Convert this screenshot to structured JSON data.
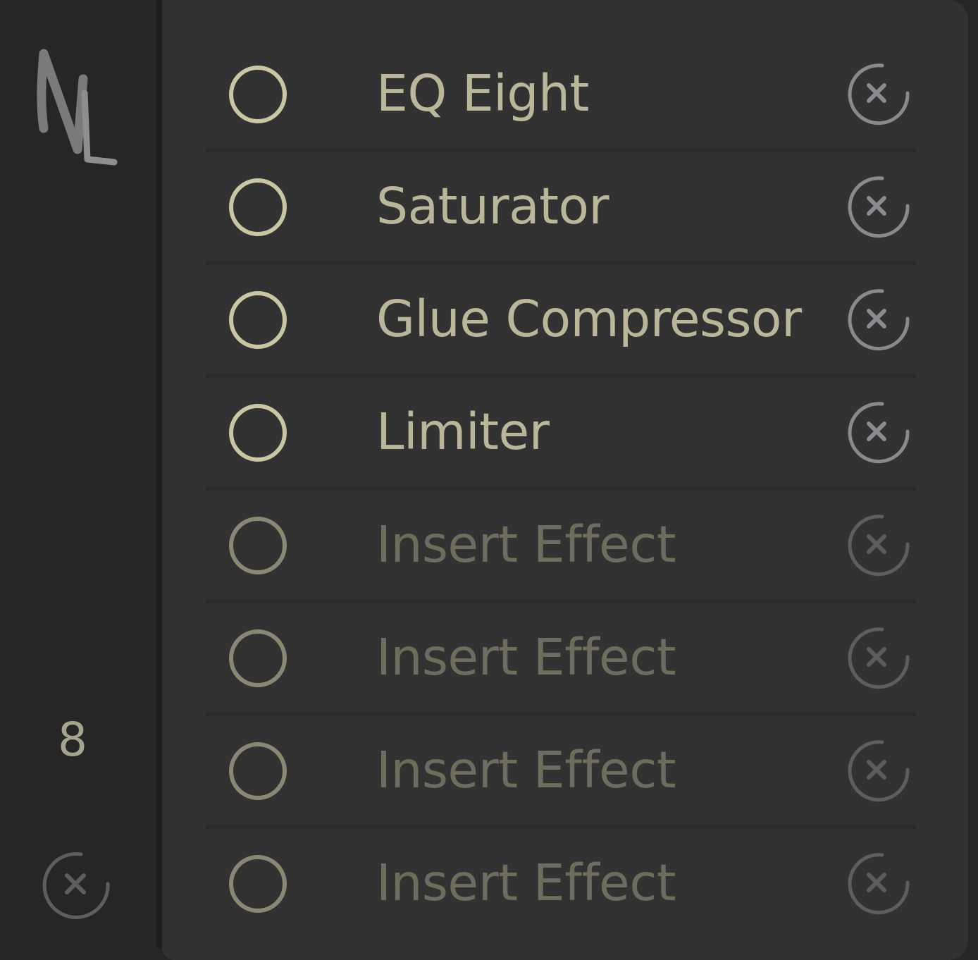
{
  "sidebar": {
    "logo_icon": "nl-logo-icon",
    "count": "8",
    "clear_icon": "close-circle-icon"
  },
  "colors": {
    "active_text": "#b9b69a",
    "inactive_text": "#6e6c5c",
    "toggle_active": "#c9c6a3",
    "toggle_inactive": "#8a8774",
    "remove_active": "#8a8a8e",
    "remove_inactive": "#5e5e5e",
    "panel_bg": "#323232",
    "sidebar_bg": "#262626"
  },
  "effects": [
    {
      "name": "EQ Eight",
      "state": "loaded"
    },
    {
      "name": "Saturator",
      "state": "loaded"
    },
    {
      "name": "Glue Compressor",
      "state": "loaded"
    },
    {
      "name": "Limiter",
      "state": "loaded"
    },
    {
      "name": "Insert Effect",
      "state": "empty"
    },
    {
      "name": "Insert Effect",
      "state": "empty"
    },
    {
      "name": "Insert Effect",
      "state": "empty"
    },
    {
      "name": "Insert Effect",
      "state": "empty"
    }
  ]
}
